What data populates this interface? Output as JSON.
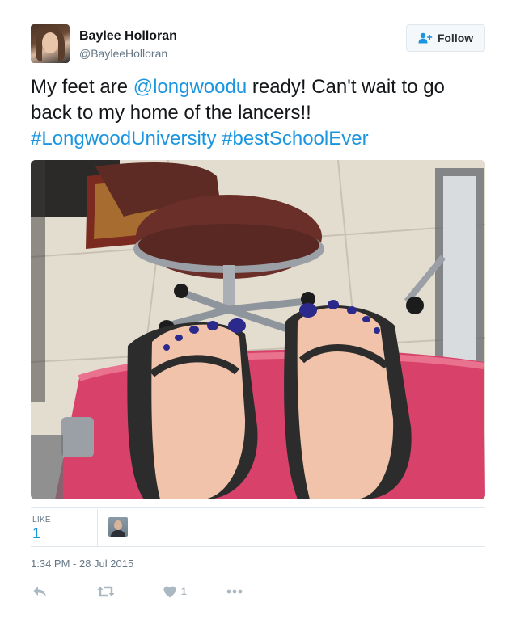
{
  "user": {
    "name": "Baylee Holloran",
    "handle": "@BayleeHolloran"
  },
  "follow_button": {
    "label": "Follow",
    "icon": "add-user-icon"
  },
  "tweet": {
    "text_part1": "My feet are ",
    "mention": "@longwoodu",
    "text_part2": " ready! Can't wait to go back to my home of the lancers!! ",
    "hashtag1": "#LongwoodUniversity",
    "text_part3": " ",
    "hashtag2": "#bestSchoolEver"
  },
  "stats": {
    "like_label": "LIKE",
    "like_count": "1"
  },
  "timestamp": "1:34 PM - 28 Jul 2015",
  "actions": {
    "reply_icon": "reply-icon",
    "retweet_icon": "retweet-icon",
    "like_icon": "heart-icon",
    "like_count": "1",
    "more_icon": "more-icon"
  },
  "colors": {
    "link": "#1b95e0",
    "text": "#14171a",
    "muted": "#657786",
    "action_icon": "#aab8c2",
    "border": "#e1e8ed"
  }
}
